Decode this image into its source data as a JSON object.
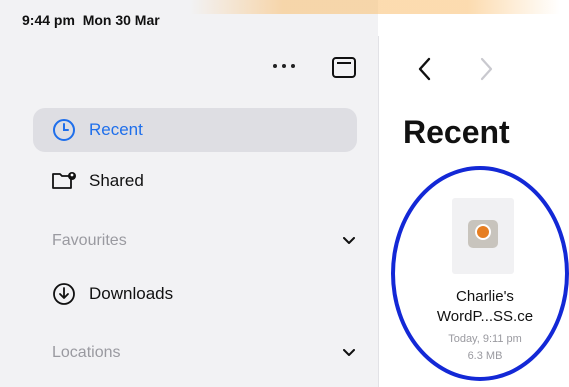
{
  "status_bar": {
    "time": "9:44 pm  Mon 30 Mar"
  },
  "toolbar": {
    "more_icon": "ellipsis-icon",
    "sidebar_icon": "sidebar-toggle-icon"
  },
  "sidebar": {
    "items": [
      {
        "label": "Recent",
        "icon": "clock-icon",
        "selected": true
      },
      {
        "label": "Shared",
        "icon": "shared-folder-icon",
        "selected": false
      }
    ],
    "sections": [
      {
        "title": "Favourites",
        "items": [
          {
            "label": "Downloads",
            "icon": "download-icon"
          }
        ]
      },
      {
        "title": "Locations",
        "items": []
      }
    ]
  },
  "content": {
    "title": "Recent",
    "navigation": {
      "back_icon": "back-chevron-icon",
      "forward_icon": "forward-chevron-icon"
    },
    "files": [
      {
        "name_line1": "Charlie's",
        "name_line2": "WordP...SS.ce",
        "date": "Today, 9:11 pm",
        "size": "6.3 MB"
      }
    ]
  },
  "colors": {
    "accent": "#1f6feb",
    "highlight_ring": "#1328d6",
    "sidebar_bg": "#f2f2f4"
  }
}
